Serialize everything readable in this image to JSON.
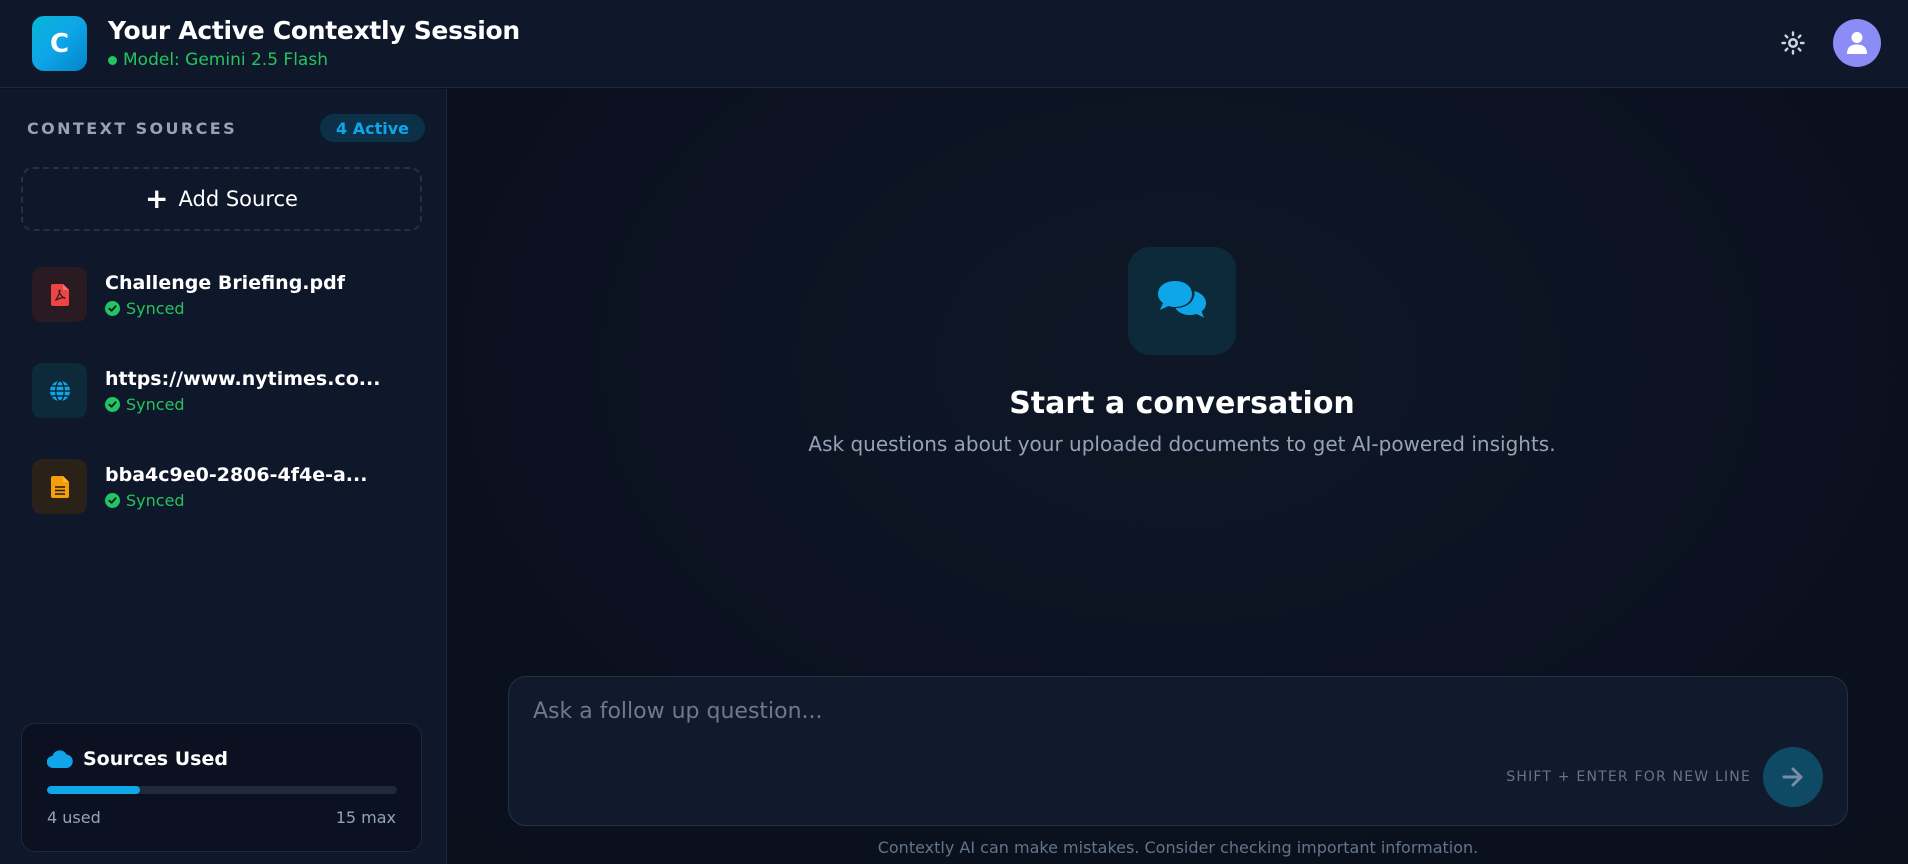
{
  "header": {
    "logo_letter": "C",
    "title": "Your Active Contextly Session",
    "model": "Model: Gemini 2.5 Flash",
    "theme_icon": "sun-icon",
    "avatar_icon": "user-icon"
  },
  "sidebar": {
    "heading": "CONTEXT SOURCES",
    "active_badge": "4 Active",
    "add_source_label": "Add Source",
    "sources": [
      {
        "name": "Challenge Briefing.pdf",
        "status": "Synced",
        "icon": "pdf-icon",
        "color": "#ef4444"
      },
      {
        "name": "https://www.nytimes.co...",
        "status": "Synced",
        "icon": "globe-icon",
        "color": "#0ea5e9"
      },
      {
        "name": "bba4c9e0-2806-4f4e-a...",
        "status": "Synced",
        "icon": "document-icon",
        "color": "#f59e0b"
      }
    ],
    "usage": {
      "title": "Sources Used",
      "icon": "cloud-icon",
      "used_label": "4 used",
      "max_label": "15 max",
      "used": 4,
      "max": 15
    }
  },
  "main": {
    "empty_icon": "chat-bubbles-icon",
    "empty_title": "Start a conversation",
    "empty_subtitle": "Ask questions about your uploaded documents to get AI-powered insights.",
    "composer": {
      "placeholder": "Ask a follow up question...",
      "value": "",
      "shortcut_hint": "SHIFT + ENTER FOR NEW LINE",
      "send_icon": "arrow-right-icon"
    },
    "disclaimer": "Contextly AI can make mistakes. Consider checking important information."
  },
  "colors": {
    "accent": "#0ea5e9",
    "success": "#22c55e",
    "background": "#0b1120",
    "panel": "#0f172a"
  }
}
